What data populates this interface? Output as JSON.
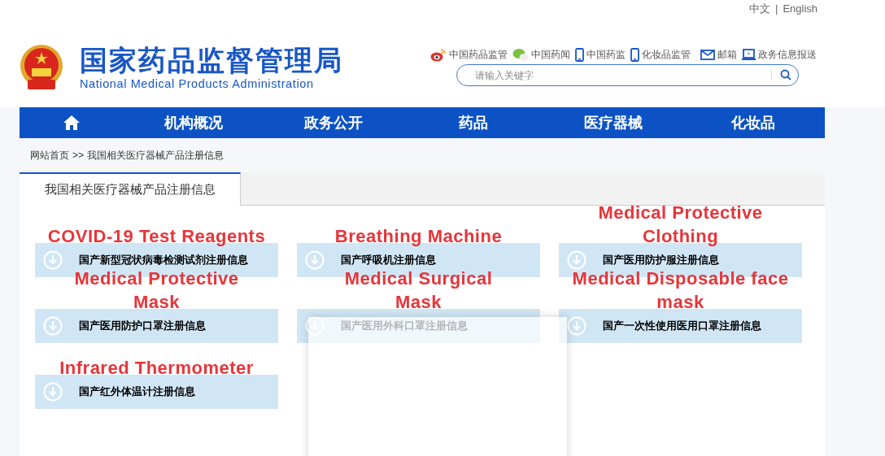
{
  "language_switch": {
    "items": [
      {
        "label": "中文"
      },
      {
        "label": "English"
      }
    ],
    "separator": "|"
  },
  "header": {
    "title": "国家药品监督管理局",
    "subtitle": "National Medical Products Administration"
  },
  "quick_links": [
    {
      "kind": "weibo",
      "label": "中国药品监管"
    },
    {
      "kind": "wechat",
      "label": "中国药闻"
    },
    {
      "kind": "mobile",
      "label": "中国药监"
    },
    {
      "kind": "mobile",
      "label": "化妆品监管"
    },
    {
      "kind": "mail",
      "label": "邮箱"
    },
    {
      "kind": "monitor",
      "label": "政务信息报送"
    }
  ],
  "search": {
    "placeholder": "请输入关键字"
  },
  "nav": [
    {
      "kind": "home"
    },
    {
      "kind": "text",
      "label": "机构概况"
    },
    {
      "kind": "text",
      "label": "政务公开"
    },
    {
      "kind": "text",
      "label": "药品"
    },
    {
      "kind": "text",
      "label": "医疗器械"
    },
    {
      "kind": "text",
      "label": "化妆品"
    }
  ],
  "breadcrumb": {
    "home": "网站首页",
    "separator": ">>",
    "current": "我国相关医疗器械产品注册信息"
  },
  "tabs": [
    {
      "label": "我国相关医疗器械产品注册信息",
      "selected": true
    }
  ],
  "cards": [
    {
      "label": "国产新型冠状病毒检测试剂注册信息",
      "annotation": [
        "COVID-19 Test Reagents"
      ]
    },
    {
      "label": "国产呼吸机注册信息",
      "annotation": [
        "Breathing Machine"
      ]
    },
    {
      "label": "国产医用防护服注册信息",
      "annotation": [
        "Medical Protective",
        "Clothing"
      ]
    },
    {
      "label": "国产医用防护口罩注册信息",
      "annotation": [
        "Medical Protective",
        "Mask"
      ]
    },
    {
      "label": "国产医用外科口罩注册信息",
      "annotation": [
        "Medical Surgical",
        "Mask"
      ]
    },
    {
      "label": "国产一次性使用医用口罩注册信息",
      "annotation": [
        "Medical Disposable face",
        "mask"
      ]
    },
    {
      "label": "国产红外体温计注册信息",
      "annotation": [
        "Infrared Thermometer"
      ]
    }
  ]
}
